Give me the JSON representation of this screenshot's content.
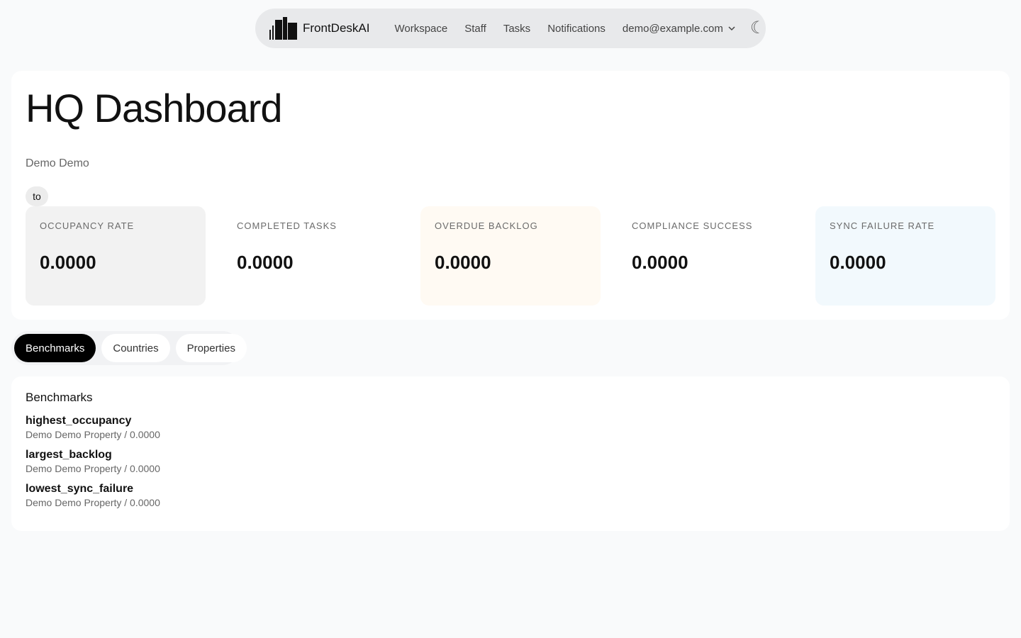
{
  "nav": {
    "brand": "FrontDeskAI",
    "links": [
      "Workspace",
      "Staff",
      "Tasks",
      "Notifications"
    ],
    "user_email": "demo@example.com"
  },
  "hero": {
    "title": "HQ Dashboard",
    "subtitle": "Demo Demo",
    "date_range_label": "to"
  },
  "metrics": [
    {
      "label": "OCCUPANCY RATE",
      "value": "0.0000",
      "bg": "#f2f2f2"
    },
    {
      "label": "COMPLETED TASKS",
      "value": "0.0000",
      "bg": "#ffffff"
    },
    {
      "label": "OVERDUE BACKLOG",
      "value": "0.0000",
      "bg": "#fffaf3"
    },
    {
      "label": "COMPLIANCE SUCCESS",
      "value": "0.0000",
      "bg": "#ffffff"
    },
    {
      "label": "SYNC FAILURE RATE",
      "value": "0.0000",
      "bg": "#f2f9fd"
    }
  ],
  "tabs": [
    {
      "label": "Benchmarks",
      "active": true
    },
    {
      "label": "Countries",
      "active": false
    },
    {
      "label": "Properties",
      "active": false
    }
  ],
  "benchmarks": {
    "title": "Benchmarks",
    "items": [
      {
        "name": "highest_occupancy",
        "detail": "Demo Demo Property / 0.0000"
      },
      {
        "name": "largest_backlog",
        "detail": "Demo Demo Property / 0.0000"
      },
      {
        "name": "lowest_sync_failure",
        "detail": "Demo Demo Property / 0.0000"
      }
    ]
  }
}
